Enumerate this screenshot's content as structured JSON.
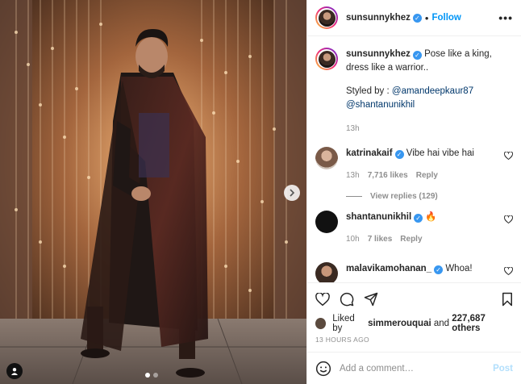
{
  "header": {
    "username": "sunsunnykhez",
    "separator": "•",
    "follow_label": "Follow",
    "more_label": "•••"
  },
  "caption": {
    "username": "sunsunnykhez",
    "text": "Pose like a king, dress like a warrior..",
    "styled_by": "Styled by :",
    "mention1": "@amandeepkaur87",
    "mention2": "@shantanunikhil",
    "time": "13h"
  },
  "comments": [
    {
      "username": "katrinakaif",
      "text": "Vibe hai vibe hai",
      "time": "13h",
      "likes": "7,716 likes",
      "reply": "Reply",
      "view_replies": "View replies (129)"
    },
    {
      "username": "shantanunikhil",
      "text": "🔥",
      "time": "10h",
      "likes": "7 likes",
      "reply": "Reply"
    },
    {
      "username": "malavikamohanan_",
      "text": "Whoa!"
    }
  ],
  "likes": {
    "prefix": "Liked by",
    "user": "simmerouquai",
    "and": "and",
    "others": "227,687 others"
  },
  "timestamp": "13 HOURS AGO",
  "add_comment": {
    "placeholder": "Add a comment…",
    "post_label": "Post"
  },
  "colors": {
    "accent": "#0095f6",
    "verified": "#3897f0",
    "post_disabled": "#b2dffc"
  },
  "carousel": {
    "slides": 2,
    "current": 1
  }
}
